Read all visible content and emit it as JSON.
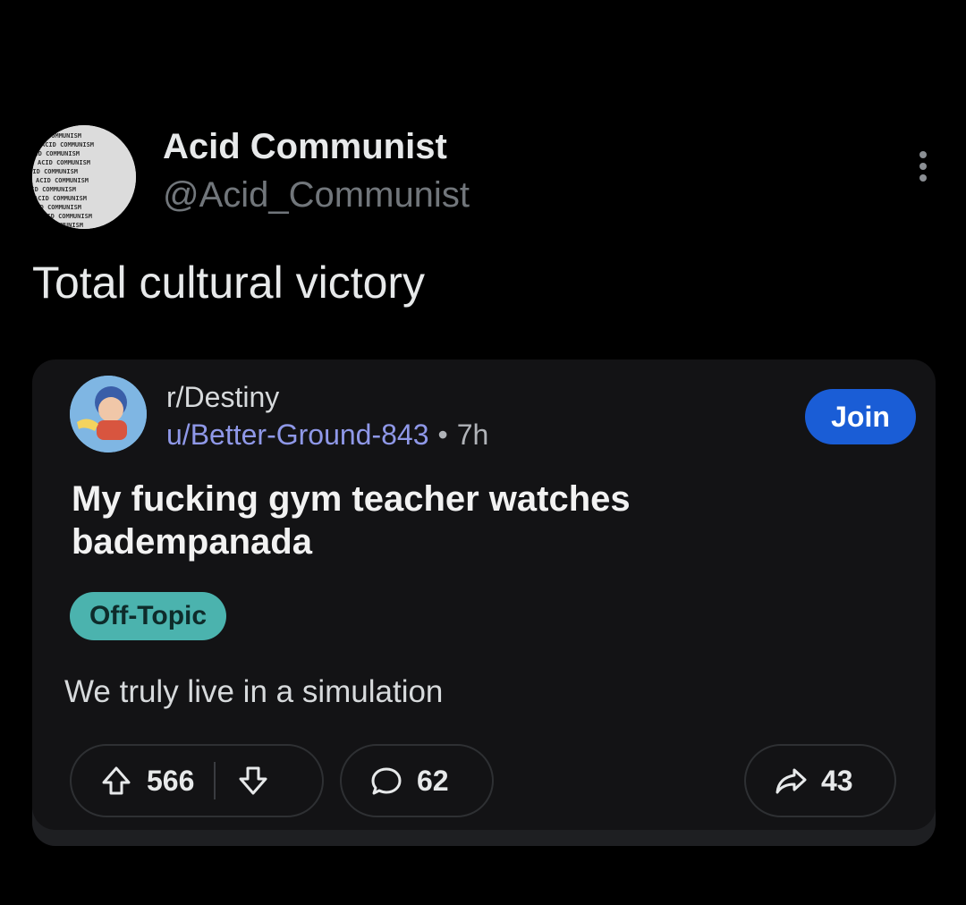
{
  "tweet": {
    "author_name": "Acid Communist",
    "author_handle": "@Acid_Communist",
    "text": "Total cultural victory",
    "avatar_pattern_text": "ACID COMMUNISM"
  },
  "reddit_post": {
    "subreddit": "r/Destiny",
    "username": "u/Better-Ground-843",
    "separator": "•",
    "time": "7h",
    "join_label": "Join",
    "title": "My fucking gym teacher watches badempanada",
    "flair": "Off-Topic",
    "body": "We truly live in a simulation",
    "upvotes": "566",
    "comments": "62",
    "shares": "43"
  },
  "colors": {
    "background": "#000000",
    "card": "#131315",
    "join_button": "#1a5dd6",
    "flair": "#4bb3ae",
    "username": "#8f98e8"
  },
  "icons": [
    "more-vertical-icon",
    "upvote-icon",
    "downvote-icon",
    "comment-icon",
    "share-icon"
  ]
}
